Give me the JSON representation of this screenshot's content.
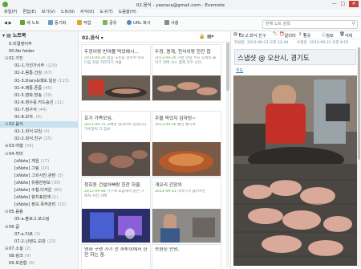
{
  "window": {
    "title": "02.음식 - yasraca@gmail.com - Evernote",
    "minimize": "—",
    "maximize": "□",
    "close": "✕"
  },
  "menu": [
    "파일(F)",
    "편집(E)",
    "보기(V)",
    "노트(N)",
    "서식(O)",
    "도구(T)",
    "도움말(H)"
  ],
  "toolbar": {
    "sync": "동기화",
    "new_note": "새 노트",
    "activity": "동기화",
    "work": "작업",
    "share": "공유",
    "url_copy": "URL 복사",
    "use": "사용",
    "search_placeholder": "전체 노트 검색"
  },
  "sidebar": {
    "root": "노트북",
    "items": [
      {
        "label": "0.미결정이무",
        "count": "",
        "indent": 1,
        "toggle": ""
      },
      {
        "label": "00.No folder",
        "count": "",
        "indent": 1,
        "toggle": ""
      },
      {
        "label": "01.가진",
        "count": "",
        "indent": 1,
        "toggle": "⊟"
      },
      {
        "label": "01-1.가진가사주",
        "count": "(129)",
        "indent": 2,
        "toggle": ""
      },
      {
        "label": "01-2.몸통.건강",
        "count": "(67)",
        "indent": 2,
        "toggle": ""
      },
      {
        "label": "01-3.Diary&메모.일상",
        "count": "(115)",
        "indent": 2,
        "toggle": ""
      },
      {
        "label": "01-4.패통.폰좀",
        "count": "(45)",
        "indent": 2,
        "toggle": ""
      },
      {
        "label": "01-5.영화.방송",
        "count": "(20)",
        "indent": 2,
        "toggle": ""
      },
      {
        "label": "01-6.영수증.카드승인",
        "count": "(11)",
        "indent": 2,
        "toggle": ""
      },
      {
        "label": "01-7.정구서",
        "count": "(44)",
        "indent": 2,
        "toggle": ""
      },
      {
        "label": "01-8.보자.",
        "count": "(6)",
        "indent": 2,
        "toggle": ""
      },
      {
        "label": "02.음식",
        "count": "",
        "indent": 1,
        "toggle": "⊟",
        "selected": true
      },
      {
        "label": "02-1.회식.모임",
        "count": "(4)",
        "indent": 2,
        "toggle": ""
      },
      {
        "label": "02-2.회식.친구",
        "count": "(25)",
        "indent": 2,
        "toggle": ""
      },
      {
        "label": "03.여행",
        "count": "(59)",
        "indent": 1,
        "toggle": "⊞"
      },
      {
        "label": "04.취미",
        "count": "",
        "indent": 1,
        "toggle": "⊟"
      },
      {
        "label": "[xNote] 게임",
        "count": "(17)",
        "indent": 2,
        "toggle": ""
      },
      {
        "label": "[xNote] 그림",
        "count": "(10)",
        "indent": 2,
        "toggle": ""
      },
      {
        "label": "[xNote] 그외사진.관련",
        "count": "(3)",
        "indent": 2,
        "toggle": ""
      },
      {
        "label": "[xNote] 유용한정보",
        "count": "(35)",
        "indent": 2,
        "toggle": ""
      },
      {
        "label": "[xNote] 수첩.다져온",
        "count": "(80)",
        "indent": 2,
        "toggle": ""
      },
      {
        "label": "[xNote] 월지표관계",
        "count": "(1)",
        "indent": 2,
        "toggle": ""
      },
      {
        "label": "[xNote] 정보.목적관리",
        "count": "(15)",
        "indent": 2,
        "toggle": ""
      },
      {
        "label": "05.음용",
        "count": "",
        "indent": 1,
        "toggle": "⊟"
      },
      {
        "label": "05-a.블로그.포스팅",
        "count": "",
        "indent": 2,
        "toggle": ""
      },
      {
        "label": "06.글",
        "count": "",
        "indent": 1,
        "toggle": "⊞"
      },
      {
        "label": "07-a.이로",
        "count": "(3)",
        "indent": 2,
        "toggle": ""
      },
      {
        "label": "07-2.닌텐도.보관",
        "count": "(22)",
        "indent": 2,
        "toggle": ""
      },
      {
        "label": "07.소설",
        "count": "(2)",
        "indent": 1,
        "toggle": "⊞"
      },
      {
        "label": "08.링크",
        "count": "(9)",
        "indent": 1,
        "toggle": ""
      },
      {
        "label": "09.보관함",
        "count": "(9)",
        "indent": 1,
        "toggle": ""
      }
    ]
  },
  "notelist": {
    "notebook": "02.음식",
    "dropdown": "▾",
    "cards": [
      {
        "title": "두정이랑 반여쫄 먹었에시...",
        "date": "2013-09-26",
        "snippet": "점심 노트를 잡아서 먹자 다음 자원 하러가기 서울"
      },
      {
        "title": "두정, 용계, 천식이랑 한잔 합",
        "date": "2013-09-26",
        "snippet": "가정 안녕 주요 집계의 들이기 전에 사스 함께 모두 나다."
      },
      {
        "title": "호가 가족모임.",
        "date": "2013-09-15",
        "snippet": "오빠한 업데이트 정합니다 가수장이 그 정보"
      },
      {
        "title": "주물 먹었지 감자탕~",
        "date": "2013-09-26",
        "snippet": "빨강 빨시켜"
      },
      {
        "title": "청호동 건설아빠랑 한잔 하줄.",
        "date": "2013-09-08",
        "snippet": "가구에 포함해서 같은 가로자 사진 시에"
      },
      {
        "title": "개오리 간장의",
        "date": "2013-09-01",
        "snippet": "이야기가 넘어서는"
      },
      {
        "title": "영화 구경 가기 전 까투이에서 한잔 하는 중.",
        "date": "",
        "snippet": ""
      },
      {
        "title": "옷환싣 안녕.",
        "date": "",
        "snippet": ""
      }
    ]
  },
  "note": {
    "notebook_selector": "02-2.회식.친구",
    "reminder": "알리미",
    "share": "공유",
    "info": "정보",
    "delete": "삭제",
    "created_label": "작성일",
    "created": "2013-09-21 오후 12:44",
    "updated_label": "수정일",
    "updated": "2013-09-21 오후 8:15",
    "title": "스냅샷 @ 오산시, 경기도",
    "map_link": "지도"
  },
  "colors": {
    "accent_green": "#5aa83d",
    "selection": "#c9e2f2",
    "link": "#2a6db0",
    "close_button": "#c9413b"
  }
}
